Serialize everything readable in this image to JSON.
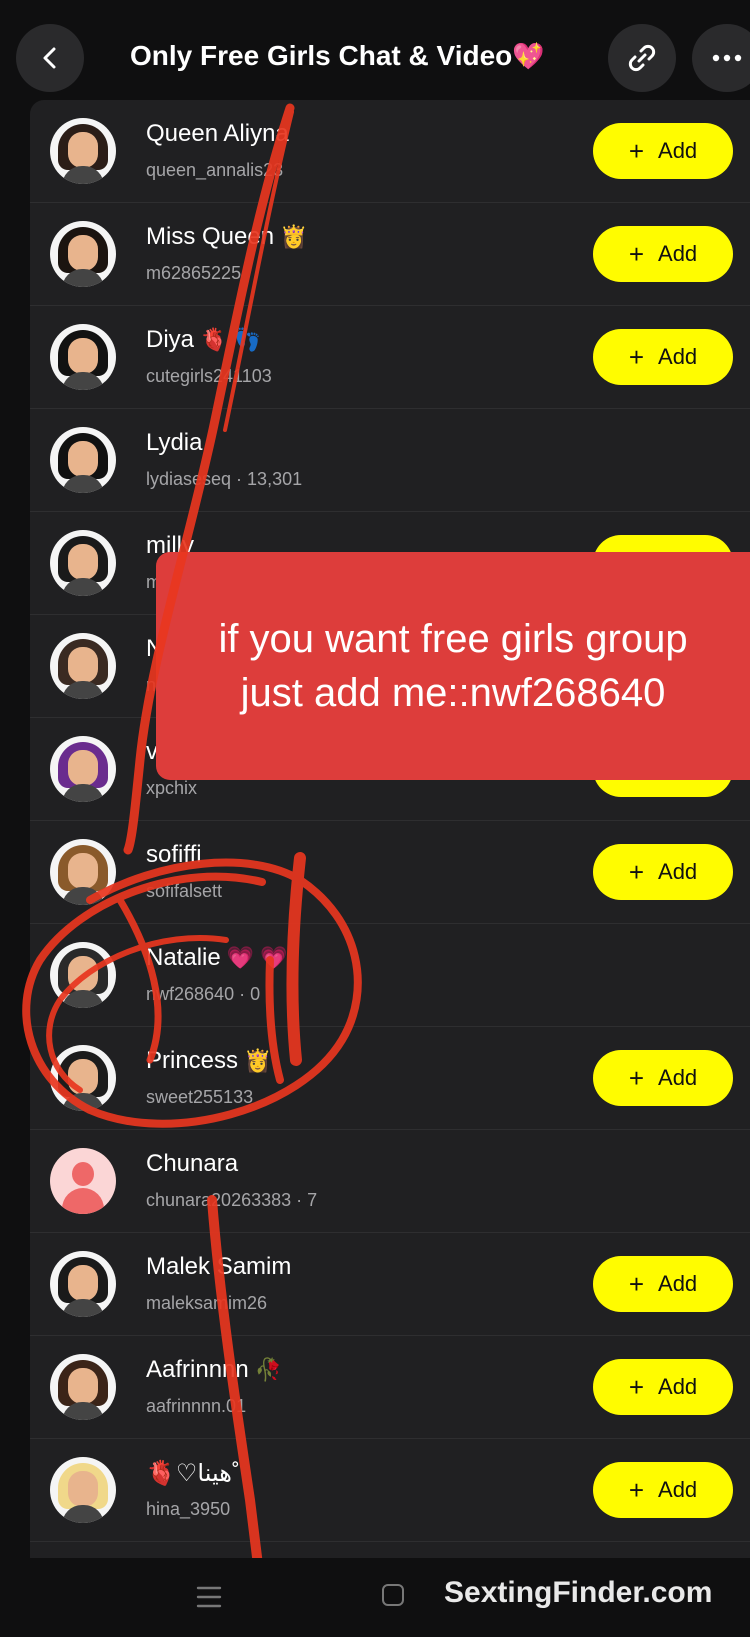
{
  "header": {
    "title": "Only Free Girls Chat & Video",
    "title_emoji": "💖",
    "back_icon": "chevron-left-icon",
    "link_icon": "link-icon",
    "more_icon": "more-horizontal-icon"
  },
  "add_label": "Add",
  "members": [
    {
      "name": "Queen Aliyna",
      "emoji": "",
      "username": "queen_annalis23",
      "has_add": true,
      "hair": "#2b1d17"
    },
    {
      "name": "Miss Queen",
      "emoji": "👸",
      "username": "m62865225",
      "has_add": true,
      "hair": "#1b1410"
    },
    {
      "name": "Diya",
      "emoji": "🫀 👣",
      "username": "cutegirls241103",
      "has_add": true,
      "hair": "#121212"
    },
    {
      "name": "Lydia",
      "emoji": "",
      "username": "lydiaseseq · 13,301",
      "has_add": false,
      "hair": "#111111"
    },
    {
      "name": "milly",
      "emoji": "",
      "username": "m",
      "has_add": true,
      "hair": "#1a1a1a"
    },
    {
      "name": "N",
      "emoji": "",
      "username": "n",
      "has_add": false,
      "hair": "#3a2a22"
    },
    {
      "name": "v",
      "emoji": "",
      "username": "xpchix",
      "has_add": true,
      "hair": "#6a2c8e"
    },
    {
      "name": "sofiffi",
      "emoji": "",
      "username": "sofifalsett",
      "has_add": true,
      "hair": "#8a5a2b"
    },
    {
      "name": "Natalie",
      "emoji": "💗 💗",
      "username": "nwf268640 · 0",
      "has_add": false,
      "hair": "#2a2a2a"
    },
    {
      "name": "Princess",
      "emoji": "👸",
      "username": "sweet255133",
      "has_add": true,
      "hair": "#1c1c1c"
    },
    {
      "name": "Chunara",
      "emoji": "",
      "username": "chunara20263383 · 7",
      "has_add": false,
      "hair": "",
      "ghost": true
    },
    {
      "name": "Malek Samim",
      "emoji": "",
      "username": "maleksamim26",
      "has_add": true,
      "hair": "#1a1a1a"
    },
    {
      "name": "Aafrinnnn",
      "emoji": "🥀",
      "username": "aafrinnnn.01",
      "has_add": true,
      "hair": "#3b2418"
    },
    {
      "name": "🫀♡هينا˚",
      "emoji": "",
      "username": "hina_3950",
      "has_add": true,
      "hair": "#f0d88a"
    }
  ],
  "overlay": {
    "line1": "if you want free girls group",
    "line2": "just add me::nwf268640"
  },
  "watermark": "SextingFinder.com",
  "colors": {
    "accent_yellow": "#fffc00",
    "overlay_red": "#dd3d3b",
    "scribble_red": "#e8361f",
    "list_bg": "#202022"
  }
}
